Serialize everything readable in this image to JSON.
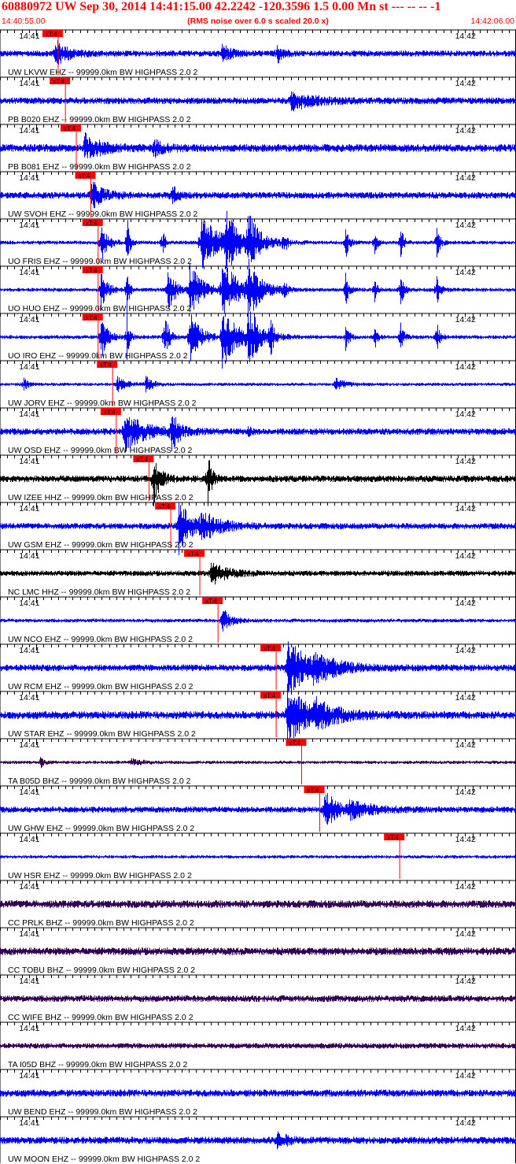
{
  "header": {
    "title": "60880972 UW Sep 30, 2014 14:41:15.00   42.2242 -120.3596  1.5 0.00 Mn st --- -- --  -1",
    "start_time": "14:40:55.00",
    "note": "(RMS noise over 6.0 s scaled 20.0 x)",
    "end_time": "14:42:06.00"
  },
  "chart_data": {
    "type": "seismogram",
    "time_start": "14:40:55.00",
    "time_end": "14:42:06.00",
    "duration_s": 71,
    "filter": "HIGHPASS  2.0  2",
    "tick_labels": [
      "14:41",
      "14:42"
    ],
    "tick_times_s": [
      5,
      65
    ],
    "pick_label": "xT:4",
    "colors": {
      "blue": "#0000ff",
      "black": "#000000",
      "purple": "#330055",
      "pick": "#ff0000",
      "grid": "#000000"
    },
    "traces": [
      {
        "label": "UW LKVW EHZ -- 99999.0km BW  HIGHPASS  2.0  2",
        "color": "blue",
        "pick_s": 8.0,
        "noise": 0.11,
        "events": [
          [
            7.5,
            0.5,
            1.5
          ],
          [
            30.5,
            0.35,
            1.0
          ],
          [
            38,
            0.4,
            0.8
          ]
        ]
      },
      {
        "label": "PB B020 EHZ -- 99999.0km BW  HIGHPASS  2.0  2",
        "color": "blue",
        "pick_s": 9.0,
        "noise": 0.12,
        "events": [
          [
            40,
            0.3,
            3
          ]
        ]
      },
      {
        "label": "PB B081 EHZ -- 99999.0km BW  HIGHPASS  2.0  2",
        "color": "blue",
        "pick_s": 10.5,
        "noise": 0.14,
        "events": [
          [
            11.5,
            0.5,
            2
          ],
          [
            21,
            0.3,
            1.2
          ]
        ]
      },
      {
        "label": "UW SVOH EHZ -- 99999.0km BW  HIGHPASS  2.0  2",
        "color": "blue",
        "pick_s": 12.5,
        "noise": 0.12,
        "events": [
          [
            12.5,
            0.5,
            1.5
          ],
          [
            23.5,
            0.4,
            0.8
          ]
        ]
      },
      {
        "label": "UO FRIS EHZ -- 99999.0km BW  HIGHPASS  2.0  2",
        "color": "blue",
        "pick_s": 13.5,
        "noise": 0.07,
        "events": [
          [
            13.8,
            0.8,
            0.8
          ],
          [
            17.4,
            1.2,
            0.3
          ],
          [
            22.3,
            0.7,
            0.3
          ],
          [
            27.5,
            1.0,
            2.5
          ],
          [
            31,
            1.0,
            1.5
          ],
          [
            34,
            1.0,
            1.5
          ],
          [
            39,
            0.6,
            0.3
          ],
          [
            47.5,
            0.6,
            0.4
          ],
          [
            51.5,
            0.5,
            0.3
          ],
          [
            55,
            0.7,
            0.4
          ],
          [
            60,
            0.7,
            0.4
          ]
        ]
      },
      {
        "label": "UO HUO EHZ -- 99999.0km BW  HIGHPASS  2.0  2",
        "color": "blue",
        "pick_s": 13.5,
        "noise": 0.07,
        "events": [
          [
            13.8,
            0.8,
            0.8
          ],
          [
            17.4,
            1.0,
            0.3
          ],
          [
            23,
            1.1,
            0.8
          ],
          [
            26,
            1.0,
            1.5
          ],
          [
            30.5,
            1.1,
            2
          ],
          [
            34,
            1.1,
            1.5
          ],
          [
            39,
            0.5,
            0.3
          ],
          [
            47.5,
            0.6,
            0.4
          ],
          [
            51.5,
            0.5,
            0.3
          ],
          [
            55,
            0.7,
            0.4
          ],
          [
            60,
            0.7,
            0.4
          ]
        ]
      },
      {
        "label": "UO IRO EHZ -- 99999.0km BW  HIGHPASS  2.0  2",
        "color": "blue",
        "pick_s": 13.5,
        "noise": 0.07,
        "events": [
          [
            13.8,
            0.9,
            0.8
          ],
          [
            17.4,
            1.0,
            0.3
          ],
          [
            22.5,
            1.0,
            0.6
          ],
          [
            26,
            1.0,
            1.3
          ],
          [
            30.5,
            1.1,
            2
          ],
          [
            34,
            1.1,
            1.5
          ],
          [
            37.2,
            0.7,
            0.3
          ],
          [
            47.5,
            0.5,
            0.4
          ],
          [
            51.5,
            0.5,
            0.3
          ],
          [
            55,
            0.6,
            0.4
          ],
          [
            60,
            0.6,
            0.4
          ]
        ]
      },
      {
        "label": "UW JORV EHZ -- 99999.0km BW  HIGHPASS  2.0  2",
        "color": "blue",
        "pick_s": 15.5,
        "noise": 0.06,
        "events": [
          [
            3.2,
            0.25,
            0.5
          ],
          [
            16,
            0.3,
            1
          ],
          [
            20,
            0.35,
            0.8
          ],
          [
            46,
            0.25,
            1.2
          ]
        ]
      },
      {
        "label": "UW OSD EHZ -- 99999.0km BW  HIGHPASS  2.0  2",
        "color": "blue",
        "pick_s": 16.0,
        "noise": 0.12,
        "events": [
          [
            17,
            0.7,
            2.5
          ],
          [
            23.5,
            0.7,
            1.0
          ],
          [
            34,
            0.25,
            0.3
          ]
        ]
      },
      {
        "label": "UW IZEE HHZ -- 99999.0km BW  HIGHPASS  2.0  2",
        "color": "black",
        "pick_s": 20.5,
        "noise": 0.12,
        "events": [
          [
            21,
            1.0,
            0.8
          ],
          [
            28.5,
            1.0,
            0.5
          ]
        ]
      },
      {
        "label": "UW GSM EHZ -- 99999.0km BW  HIGHPASS  2.0  2",
        "color": "blue",
        "pick_s": 23.5,
        "noise": 0.11,
        "events": [
          [
            24.5,
            1.0,
            1.5
          ],
          [
            27.5,
            0.5,
            2.5
          ]
        ]
      },
      {
        "label": "NC LMC HHZ -- 99999.0km BW  HIGHPASS  2.0  2",
        "color": "black",
        "pick_s": 27.5,
        "noise": 0.1,
        "events": [
          [
            29,
            0.4,
            2
          ]
        ]
      },
      {
        "label": "UW NCO EHZ -- 99999.0km BW  HIGHPASS  2.0  2",
        "color": "blue",
        "pick_s": 30.0,
        "noise": 0.07,
        "events": [
          [
            30.5,
            0.5,
            1
          ]
        ]
      },
      {
        "label": "UW RCM EHZ -- 99999.0km BW  HIGHPASS  2.0  2",
        "color": "blue",
        "pick_s": 38.0,
        "noise": 0.12,
        "events": [
          [
            39.5,
            1.1,
            2.5
          ],
          [
            43,
            0.4,
            3
          ]
        ]
      },
      {
        "label": "UW STAR EHZ -- 99999.0km BW  HIGHPASS  2.0  2",
        "color": "blue",
        "pick_s": 38.0,
        "noise": 0.14,
        "events": [
          [
            39.5,
            1.1,
            2.5
          ],
          [
            43,
            0.4,
            3
          ]
        ]
      },
      {
        "label": "TA B05D BHZ -- 99999.0km BW  HIGHPASS  2.0  2",
        "color": "purple",
        "pick_s": 41.5,
        "noise": 0.06,
        "events": [
          [
            5.5,
            0.2,
            0.5
          ],
          [
            18,
            0.12,
            1.5
          ]
        ]
      },
      {
        "label": "UW GHW EHZ -- 99999.0km BW  HIGHPASS  2.0  2",
        "color": "blue",
        "pick_s": 44.0,
        "noise": 0.11,
        "events": [
          [
            44.5,
            0.8,
            1.5
          ],
          [
            48,
            0.3,
            3
          ]
        ]
      },
      {
        "label": "UW HSR EHZ -- 99999.0km BW  HIGHPASS  2.0  2",
        "color": "blue",
        "pick_s": 55.0,
        "noise": 0.06,
        "events": []
      },
      {
        "label": "CC PRLK BHZ -- 99999.0km BW  HIGHPASS  2.0  2",
        "color": "purple",
        "pick_s": null,
        "noise": 0.14,
        "events": []
      },
      {
        "label": "CC TOBU BHZ -- 99999.0km BW  HIGHPASS  2.0  2",
        "color": "purple",
        "pick_s": null,
        "noise": 0.14,
        "events": []
      },
      {
        "label": "CC WIFE BHZ -- 99999.0km BW  HIGHPASS  2.0  2",
        "color": "purple",
        "pick_s": null,
        "noise": 0.12,
        "events": []
      },
      {
        "label": "TA I05D BHZ -- 99999.0km BW  HIGHPASS  2.0  2",
        "color": "purple",
        "pick_s": null,
        "noise": 0.1,
        "events": []
      },
      {
        "label": "UW BEND EHZ -- 99999.0km BW  HIGHPASS  2.0  2",
        "color": "blue",
        "pick_s": null,
        "noise": 0.13,
        "events": []
      },
      {
        "label": "UW MOON EHZ -- 99999.0km BW  HIGHPASS  2.0  2",
        "color": "blue",
        "pick_s": null,
        "noise": 0.13,
        "events": [
          [
            38,
            0.25,
            1.5
          ]
        ]
      }
    ]
  }
}
